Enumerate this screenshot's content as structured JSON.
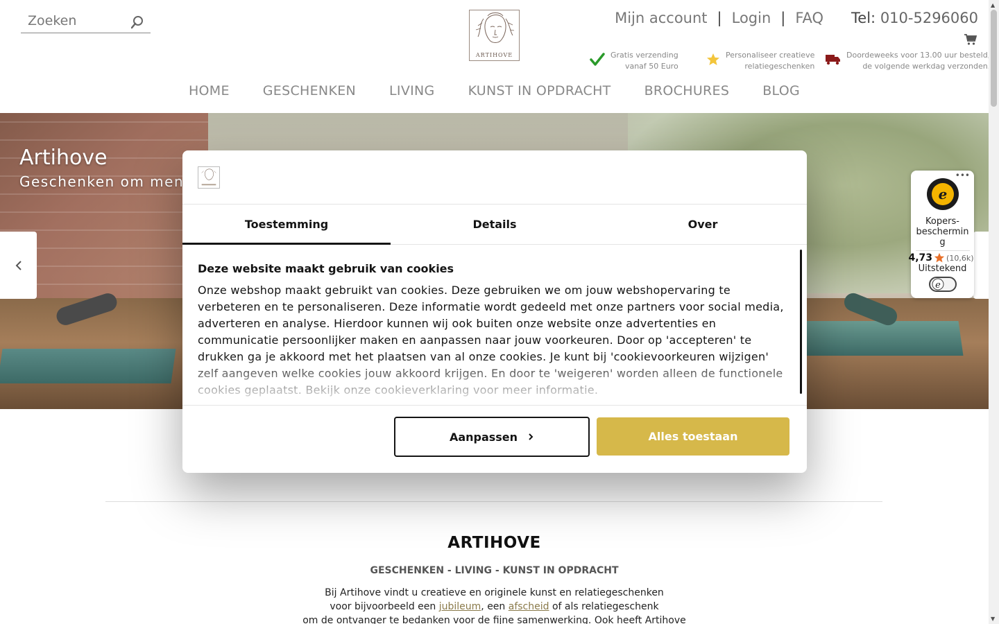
{
  "header": {
    "search_placeholder": "Zoeken",
    "logo_text": "ARTIHOVE",
    "links": [
      "Mijn account",
      "Login",
      "FAQ"
    ],
    "tel_label": "Tel:",
    "tel_number": "010-5296060",
    "usps": [
      {
        "line1": "Gratis verzending",
        "line2": "vanaf 50 Euro"
      },
      {
        "line1": "Personaliseer creatieve",
        "line2": "relatiegeschenken"
      },
      {
        "line1": "Doordeweeks voor 13.00 uur besteld,",
        "line2": "de volgende werkdag verzonden."
      }
    ],
    "nav": [
      "HOME",
      "GESCHENKEN",
      "LIVING",
      "KUNST IN OPDRACHT",
      "BROCHURES",
      "BLOG"
    ]
  },
  "hero": {
    "title": "Artihove",
    "subtitle": "Geschenken om mens"
  },
  "trusted_shops": {
    "label": "Kopers-beschermin g",
    "label_lines": [
      "Kopers-",
      "beschermin",
      "g"
    ],
    "score": "4,73",
    "count": "(10,6k)",
    "grade": "Uitstekend",
    "star_color": "#e8702a"
  },
  "cookie_dialog": {
    "tabs": [
      "Toestemming",
      "Details",
      "Over"
    ],
    "active_tab": "Toestemming",
    "heading": "Deze website maakt gebruik van cookies",
    "body": "Onze webshop maakt gebruikt van cookies. Deze gebruiken we om jouw webshopervaring te verbeteren en te personaliseren. Deze informatie wordt gedeeld met onze partners voor social media, adverteren en analyse. Hierdoor kunnen wij ook buiten onze website onze advertenties en communicatie persoonlijker maken en aanpassen naar jouw voorkeuren. Door op 'accepteren' te drukken ga je akkoord met het plaatsen van al onze cookies. Je kunt bij 'cookievoorkeuren wijzigen' zelf aangeven welke cookies jouw akkoord krijgen. En door te 'weigeren' worden alleen de functionele cookies geplaatst. Bekijk onze cookieverklaring voor meer informatie.",
    "btn_adjust": "Aanpassen",
    "btn_allow_all": "Alles toestaan",
    "accent_color": "#d6b84a"
  },
  "about": {
    "title": "ARTIHOVE",
    "sub_parts": [
      "GESCHENKEN",
      "LIVING",
      "KUNST IN OPDRACHT"
    ],
    "sub_sep": " - ",
    "text_line1": "Bij Artihove vindt u creatieve en originele kunst en relatiegeschenken",
    "text_line2_a": "voor bijvoorbeeld een ",
    "text_line2_link1": "jubileum",
    "text_line2_b": ", een ",
    "text_line2_link2": "afscheid",
    "text_line2_c": " of als relatiegeschenk",
    "text_line3": "om de ontvanger te bedanken voor de fijne samenwerking. Ook heeft Artihove"
  }
}
